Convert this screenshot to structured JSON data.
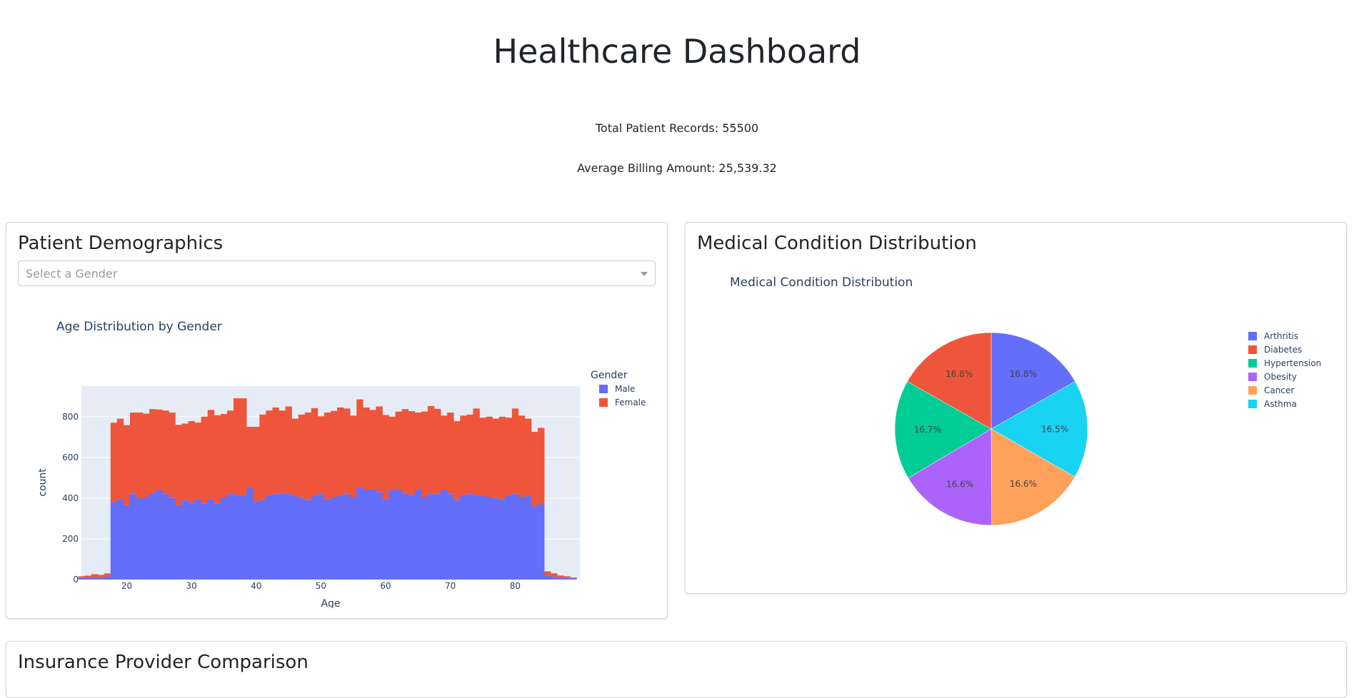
{
  "page": {
    "title": "Healthcare Dashboard",
    "total_records_text": "Total Patient Records: 55500",
    "avg_billing_text": "Average Billing Amount: 25,539.32"
  },
  "demographics": {
    "card_title": "Patient Demographics",
    "dropdown_placeholder": "Select a Gender"
  },
  "conditions": {
    "card_title": "Medical Condition Distribution"
  },
  "insurance": {
    "card_title": "Insurance Provider Comparison"
  },
  "colors": {
    "male": "#636efa",
    "female": "#ef553b",
    "plot_bg": "#e5ecf6",
    "arthritis": "#636efa",
    "diabetes": "#ef553b",
    "hypertension": "#00cc96",
    "obesity": "#ab63fa",
    "cancer": "#ffa15a",
    "asthma": "#19d3f3"
  },
  "chart_data": [
    {
      "type": "bar",
      "stacked": true,
      "title": "Age Distribution by Gender",
      "xlabel": "Age",
      "ylabel": "count",
      "legend_title": "Gender",
      "legend_position": "top-right",
      "grid": true,
      "xlim": [
        13,
        90
      ],
      "ylim": [
        0,
        950
      ],
      "xticks": [
        20,
        30,
        40,
        50,
        60,
        70,
        80
      ],
      "yticks": [
        0,
        200,
        400,
        600,
        800
      ],
      "x": [
        13,
        14,
        15,
        16,
        17,
        18,
        19,
        20,
        21,
        22,
        23,
        24,
        25,
        26,
        27,
        28,
        29,
        30,
        31,
        32,
        33,
        34,
        35,
        36,
        37,
        38,
        39,
        40,
        41,
        42,
        43,
        44,
        45,
        46,
        47,
        48,
        49,
        50,
        51,
        52,
        53,
        54,
        55,
        56,
        57,
        58,
        59,
        60,
        61,
        62,
        63,
        64,
        65,
        66,
        67,
        68,
        69,
        70,
        71,
        72,
        73,
        74,
        75,
        76,
        77,
        78,
        79,
        80,
        81,
        82,
        83,
        84,
        85,
        86,
        87,
        88,
        89
      ],
      "series": [
        {
          "name": "Male",
          "values": [
            8,
            9,
            13,
            11,
            15,
            380,
            395,
            365,
            420,
            398,
            405,
            425,
            440,
            420,
            400,
            365,
            390,
            378,
            395,
            372,
            395,
            372,
            405,
            420,
            415,
            410,
            450,
            385,
            390,
            415,
            420,
            425,
            420,
            410,
            400,
            390,
            410,
            420,
            395,
            405,
            410,
            420,
            405,
            450,
            440,
            445,
            430,
            395,
            440,
            440,
            425,
            415,
            440,
            405,
            420,
            420,
            440,
            420,
            390,
            415,
            420,
            410,
            410,
            405,
            400,
            395,
            415,
            420,
            405,
            410,
            360,
            370,
            20,
            15,
            10,
            8,
            6
          ]
        },
        {
          "name": "Female",
          "values": [
            8,
            10,
            13,
            12,
            15,
            390,
            395,
            393,
            400,
            422,
            410,
            412,
            395,
            410,
            420,
            395,
            376,
            400,
            376,
            428,
            438,
            435,
            408,
            410,
            475,
            480,
            300,
            365,
            420,
            415,
            425,
            405,
            430,
            380,
            410,
            430,
            432,
            382,
            425,
            423,
            435,
            420,
            400,
            435,
            405,
            388,
            420,
            413,
            360,
            385,
            412,
            412,
            380,
            420,
            432,
            418,
            365,
            400,
            388,
            390,
            390,
            430,
            385,
            395,
            390,
            405,
            380,
            420,
            400,
            380,
            365,
            375,
            20,
            15,
            10,
            8,
            4
          ]
        }
      ]
    },
    {
      "type": "pie",
      "title": "Medical Condition Distribution",
      "legend_position": "right",
      "categories": [
        "Arthritis",
        "Diabetes",
        "Hypertension",
        "Obesity",
        "Cancer",
        "Asthma"
      ],
      "values": [
        16.8,
        16.8,
        16.7,
        16.6,
        16.6,
        16.5
      ],
      "labels": [
        "16.8%",
        "16.8%",
        "16.7%",
        "16.6%",
        "16.6%",
        "16.5%"
      ]
    }
  ]
}
